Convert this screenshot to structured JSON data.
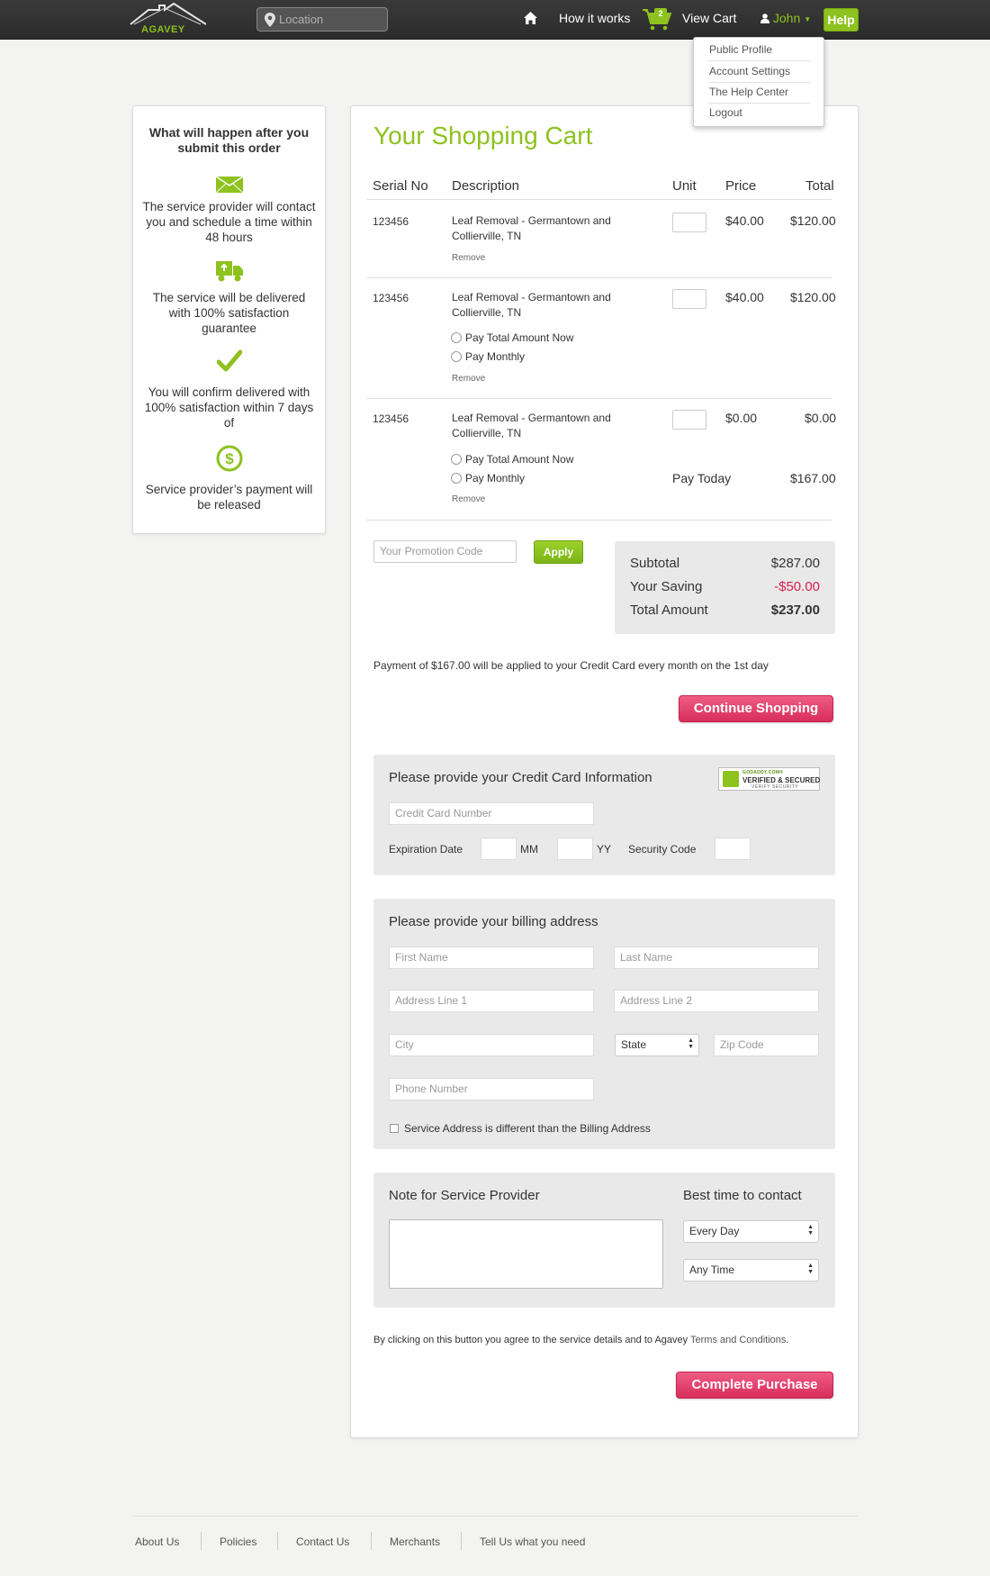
{
  "header": {
    "logo_text": "AGAVEY",
    "location_placeholder": "Location",
    "nav_how": "How it works",
    "cart_count": "2",
    "nav_view_cart": "View Cart",
    "user_name": "John",
    "help_label": "Help"
  },
  "user_menu": {
    "items": [
      "Public Profile",
      "Account Settings",
      "The Help Center",
      "Logout"
    ]
  },
  "sidebar": {
    "title": "What will happen after you submit this order",
    "steps": [
      {
        "icon": "envelope-icon",
        "text": "The service provider will contact you and schedule a time within 48 hours"
      },
      {
        "icon": "truck-icon",
        "text": "The service will be delivered with 100% satisfaction guarantee"
      },
      {
        "icon": "checkmark-icon",
        "text": "You will confirm delivered with 100% satisfaction within 7 days of"
      },
      {
        "icon": "dollar-coin-icon",
        "text": "Service provider’s payment will be released"
      }
    ]
  },
  "cart": {
    "title": "Your Shopping Cart",
    "columns": [
      "Serial No",
      "Description",
      "Unit",
      "Price",
      "Total"
    ],
    "rows": [
      {
        "serial": "123456",
        "description": "Leaf Removal - Germantown and Collierville, TN",
        "price": "$40.00",
        "total": "$120.00",
        "remove": "Remove"
      },
      {
        "serial": "123456",
        "description": "Leaf Removal - Germantown and Collierville, TN",
        "price": "$40.00",
        "total": "$120.00",
        "pay_total": "Pay Total Amount Now",
        "pay_monthly": "Pay Monthly",
        "remove": "Remove"
      },
      {
        "serial": "123456",
        "description": "Leaf Removal - Germantown and Collierville, TN",
        "price": "$0.00",
        "total": "$0.00",
        "pay_total": "Pay Total Amount Now",
        "pay_monthly": "Pay Monthly",
        "remove": "Remove",
        "pay_today_label": "Pay Today",
        "pay_today_value": "$167.00"
      }
    ],
    "promo_placeholder": "Your Promotion Code",
    "apply_label": "Apply",
    "summary": {
      "subtotal_label": "Subtotal",
      "subtotal": "$287.00",
      "saving_label": "Your Saving",
      "saving": "-$50.00",
      "total_label": "Total Amount",
      "total": "$237.00"
    },
    "payment_note": "Payment of $167.00 will be applied to your Credit Card every month on the 1st day",
    "continue_label": "Continue Shopping"
  },
  "credit_card": {
    "title": "Please provide your Credit Card Information",
    "badge_top": "GODADDY.COM®",
    "badge_main": "VERIFIED & SECURED",
    "badge_bottom": "VERIFY SECURITY",
    "number_placeholder": "Credit Card Number",
    "expiration_label": "Expiration Date",
    "mm_label": "MM",
    "yy_label": "YY",
    "security_label": "Security Code"
  },
  "billing": {
    "title": "Please provide your billing address",
    "first_name": "First Name",
    "last_name": "Last Name",
    "address1": "Address Line 1",
    "address2": "Address Line 2",
    "city": "City",
    "state": "State",
    "zip": "Zip Code",
    "phone": "Phone Number",
    "different_address": "Service Address is different than the Billing Address"
  },
  "note_section": {
    "title": "Note for Service Provider",
    "best_time_title": "Best time to contact",
    "day_value": "Every Day",
    "time_value": "Any Time"
  },
  "terms": {
    "text": "By clicking on this button you agree to the service details and to Agavey ",
    "link": "Terms and Conditions",
    "end": "."
  },
  "complete_label": "Complete Purchase",
  "footer": {
    "links": [
      "About Us",
      "Policies",
      "Contact Us",
      "Merchants",
      "Tell Us what you need"
    ]
  },
  "colors": {
    "brand_green": "#8dc21f",
    "accent_pink": "#d82d5c",
    "saving_red": "#d6204e"
  }
}
